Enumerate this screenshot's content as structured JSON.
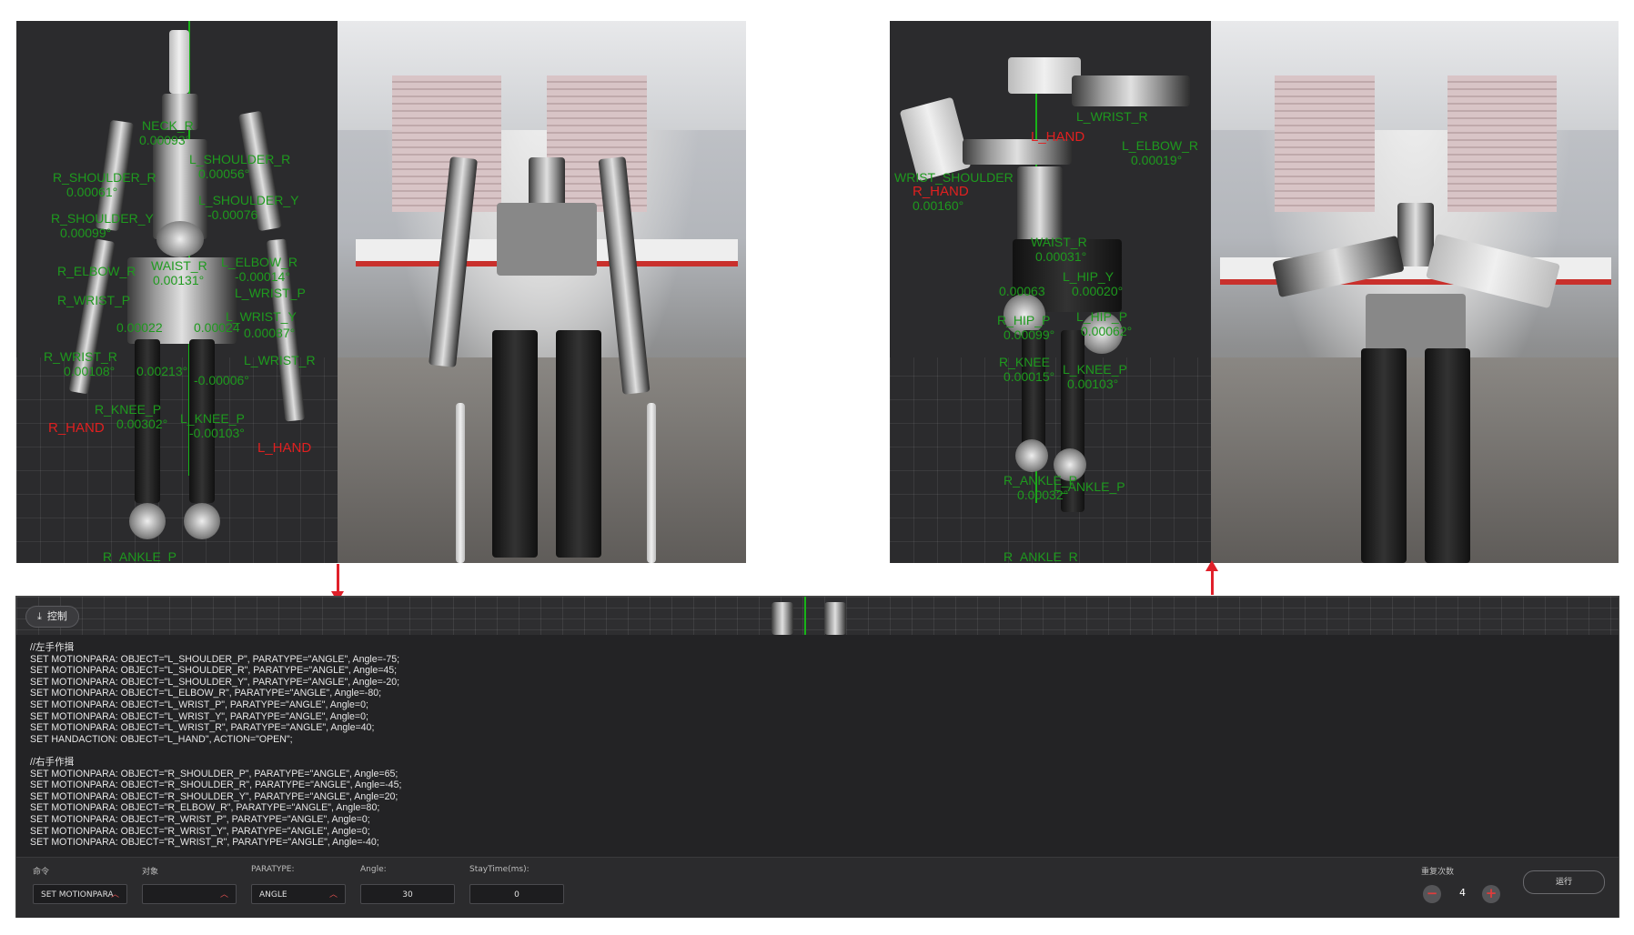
{
  "top_left": {
    "labels": [
      "NECK_R",
      "0.00093°",
      "R_SHOULDER_R",
      "0.00061°",
      "L_SHOULDER_R",
      "0.00056°",
      "L_SHOULDER_Y",
      "-0.00076",
      "R_SHOULDER_Y",
      "0.00099°",
      "R_ELBOW_R",
      "L_ELBOW_R",
      "WAIST_R",
      "0.00131°",
      "-0.00014°",
      "R_WRIST_P",
      "L_WRIST_P",
      "L_WRIST_Y",
      "0.00022",
      "0.00024",
      "0.00087°",
      "R_WRIST_R",
      "0.00108°",
      "0.00213°",
      "-0.00006°",
      "L_WRIST_R",
      "R_KNEE_P",
      "0.00302°",
      "L_KNEE_P",
      "-0.00103°",
      "R_ANKLE_P"
    ],
    "red_labels": [
      "R_HAND",
      "L_HAND"
    ]
  },
  "top_right": {
    "labels": [
      "L_WRIST_R",
      "L_ELBOW_R",
      "WRIST_SHOULDER",
      "0.00160°",
      "0.00019°",
      "WAIST_R",
      "0.00031°",
      "L_HIP_Y",
      "0.00063",
      "0.00020°",
      "R_HIP_P",
      "L_HIP_P",
      "0.00099°",
      "0.00062°",
      "R_KNEE",
      "L_KNEE_P",
      "0.00015°",
      "0.00103°",
      "R_ANKLE_P",
      "L_ANKLE_P",
      "0.00032°",
      "R_ANKLE_R"
    ],
    "red_labels": [
      "L_HAND",
      "R_HAND"
    ]
  },
  "control": {
    "button_label": "控制",
    "script_lines": [
      "//左手作揖",
      "SET MOTIONPARA: OBJECT=\"L_SHOULDER_P\", PARATYPE=\"ANGLE\", Angle=-75;",
      "SET MOTIONPARA: OBJECT=\"L_SHOULDER_R\", PARATYPE=\"ANGLE\", Angle=45;",
      "SET MOTIONPARA: OBJECT=\"L_SHOULDER_Y\", PARATYPE=\"ANGLE\", Angle=-20;",
      "SET MOTIONPARA: OBJECT=\"L_ELBOW_R\", PARATYPE=\"ANGLE\", Angle=-80;",
      "SET MOTIONPARA: OBJECT=\"L_WRIST_P\", PARATYPE=\"ANGLE\", Angle=0;",
      "SET MOTIONPARA: OBJECT=\"L_WRIST_Y\", PARATYPE=\"ANGLE\", Angle=0;",
      "SET MOTIONPARA: OBJECT=\"L_WRIST_R\", PARATYPE=\"ANGLE\", Angle=40;",
      "SET HANDACTION: OBJECT=\"L_HAND\", ACTION=\"OPEN\";",
      "",
      "//右手作揖",
      "SET MOTIONPARA: OBJECT=\"R_SHOULDER_P\", PARATYPE=\"ANGLE\", Angle=65;",
      "SET MOTIONPARA: OBJECT=\"R_SHOULDER_R\", PARATYPE=\"ANGLE\", Angle=-45;",
      "SET MOTIONPARA: OBJECT=\"R_SHOULDER_Y\", PARATYPE=\"ANGLE\", Angle=20;",
      "SET MOTIONPARA: OBJECT=\"R_ELBOW_R\", PARATYPE=\"ANGLE\", Angle=80;",
      "SET MOTIONPARA: OBJECT=\"R_WRIST_P\", PARATYPE=\"ANGLE\", Angle=0;",
      "SET MOTIONPARA: OBJECT=\"R_WRIST_Y\", PARATYPE=\"ANGLE\", Angle=0;",
      "SET MOTIONPARA: OBJECT=\"R_WRIST_R\", PARATYPE=\"ANGLE\", Angle=-40;"
    ],
    "fields": {
      "command_label": "命令",
      "command_value": "SET MOTIONPARA",
      "object_label": "对象",
      "object_value": "",
      "paratype_label": "PARATYPE:",
      "paratype_value": "ANGLE",
      "angle_label": "Angle:",
      "angle_value": "30",
      "staytime_label": "StayTime(ms):",
      "staytime_value": "0"
    },
    "repeat": {
      "label": "重复次数",
      "value": "4",
      "minus": "−",
      "plus": "+"
    },
    "run_label": "运行"
  },
  "colors": {
    "label_green": "#1e9a1e",
    "label_red": "#e02020",
    "arrow_red": "#e0202a",
    "panel_bg": "#232325"
  }
}
